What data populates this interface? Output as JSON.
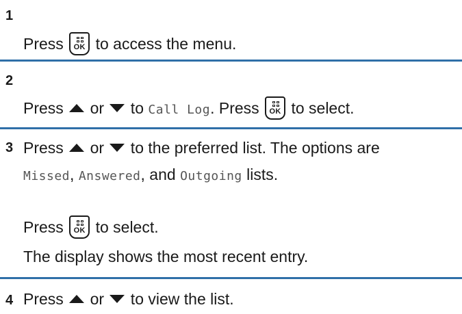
{
  "steps": [
    {
      "number": "1",
      "lines": [
        {
          "t1": "Press ",
          "t2": " to access the menu."
        }
      ]
    },
    {
      "number": "2",
      "lines": [
        {
          "t1": "Press ",
          "t2": " or ",
          "t3": " to ",
          "mono": "Call Log",
          "t4": ". Press ",
          "t5": " to select."
        }
      ]
    },
    {
      "number": "3",
      "lines": [
        {
          "t1": "Press ",
          "t2": " or ",
          "t3": " to the preferred list. The options are"
        },
        {
          "mono1": "Missed",
          "t1": ", ",
          "mono2": "Answered",
          "t2": ", and ",
          "mono3": "Outgoing",
          "t3": " lists."
        },
        {
          "t1": "Press ",
          "t2": " to select."
        },
        {
          "t1": "The display shows the most recent entry."
        }
      ]
    },
    {
      "number": "4",
      "lines": [
        {
          "t1": "Press ",
          "t2": " or ",
          "t3": " to view the list."
        }
      ]
    }
  ],
  "ok_key_label": "OK",
  "icons": {
    "ok": "menu-ok-key-icon",
    "up": "up-arrow-icon",
    "down": "down-arrow-icon"
  },
  "colors": {
    "rule": "#2f6fa8"
  }
}
